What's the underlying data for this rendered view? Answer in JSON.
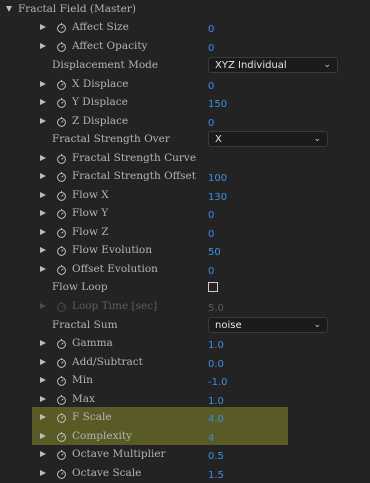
{
  "section": {
    "title": "Fractal Field (Master)"
  },
  "rows": [
    {
      "label": "Affect Size",
      "value": "0"
    },
    {
      "label": "Affect Opacity",
      "value": "0"
    },
    {
      "label": "Displacement Mode",
      "select": "XYZ Individual"
    },
    {
      "label": "X Displace",
      "value": "0"
    },
    {
      "label": "Y Displace",
      "value": "150"
    },
    {
      "label": "Z Displace",
      "value": "0"
    },
    {
      "label": "Fractal Strength Over",
      "select": "X"
    },
    {
      "label": "Fractal Strength Curve",
      "value": ""
    },
    {
      "label": "Fractal Strength Offset",
      "value": "100"
    },
    {
      "label": "Flow X",
      "value": "130"
    },
    {
      "label": "Flow Y",
      "value": "0"
    },
    {
      "label": "Flow Z",
      "value": "0"
    },
    {
      "label": "Flow Evolution",
      "value": "50"
    },
    {
      "label": "Offset Evolution",
      "value": "0"
    },
    {
      "label": "Flow Loop",
      "checkbox": false
    },
    {
      "label": "Loop Time [sec]",
      "value": "5.0",
      "disabled": true
    },
    {
      "label": "Fractal Sum",
      "select": "noise"
    },
    {
      "label": "Gamma",
      "value": "1.0"
    },
    {
      "label": "Add/Subtract",
      "value": "0.0"
    },
    {
      "label": "Min",
      "value": "-1.0"
    },
    {
      "label": "Max",
      "value": "1.0"
    },
    {
      "label": "F Scale",
      "value": "4.0",
      "highlighted": true
    },
    {
      "label": "Complexity",
      "value": "4",
      "highlighted": true
    },
    {
      "label": "Octave Multiplier",
      "value": "0.5"
    },
    {
      "label": "Octave Scale",
      "value": "1.5"
    }
  ],
  "colors": {
    "value": "#3d8fe6",
    "highlight": "#5a5a26",
    "background": "#232323"
  },
  "icons": {
    "twirl": "triangle-right-icon",
    "stopwatch": "stopwatch-icon",
    "dropdown": "chevron-down-icon"
  }
}
